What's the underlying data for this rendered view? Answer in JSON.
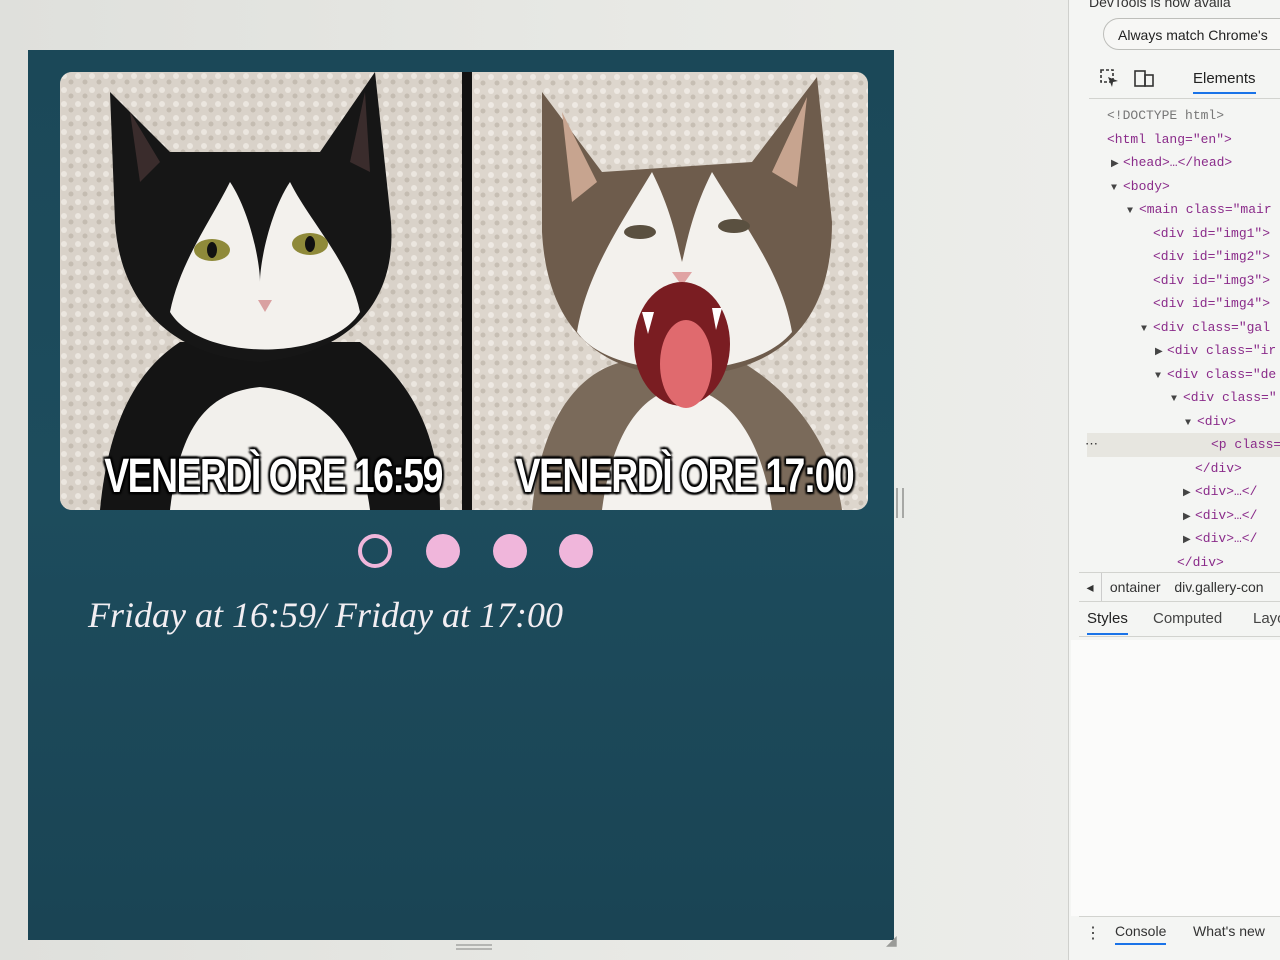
{
  "gallery": {
    "images": [
      {
        "caption": "VENERDÌ ORE 16:59",
        "subject": "black-and-white cat, grumpy expression"
      },
      {
        "caption": "VENERDÌ ORE 17:00",
        "subject": "tabby-and-white cat, mouth wide open"
      }
    ],
    "indicators": [
      {
        "state": "active"
      },
      {
        "state": "inactive"
      },
      {
        "state": "inactive"
      },
      {
        "state": "inactive"
      }
    ],
    "description": "Friday at 16:59/ Friday at 17:00"
  },
  "colors": {
    "panel_bg": "#1c4a5a",
    "indicator": "#f0b6db",
    "description_text": "#f2eef2"
  },
  "devtools": {
    "banner_text": "DevTools is now availa",
    "pill_text": "Always match Chrome's",
    "tabs": {
      "elements": "Elements"
    },
    "dom": [
      {
        "text": "<!DOCTYPE html>"
      },
      {
        "text": "<html lang=\"en\">"
      },
      {
        "text": "<head>…</head>"
      },
      {
        "text": "<body>"
      },
      {
        "text": "<main class=\"mair"
      },
      {
        "text": "<div id=\"img1\">"
      },
      {
        "text": "<div id=\"img2\">"
      },
      {
        "text": "<div id=\"img3\">"
      },
      {
        "text": "<div id=\"img4\">"
      },
      {
        "text": "<div class=\"gal"
      },
      {
        "text": "<div class=\"ir"
      },
      {
        "text": "<div class=\"de"
      },
      {
        "text": "<div class=\""
      },
      {
        "text": "<div>"
      },
      {
        "text": "<p class="
      },
      {
        "text": "</div>"
      },
      {
        "text": "<div>…</"
      },
      {
        "text": "<div>…</"
      },
      {
        "text": "<div>…</"
      },
      {
        "text": "</div>"
      }
    ],
    "breadcrumb": [
      "ontainer",
      "div.gallery-con"
    ],
    "subtabs": [
      "Styles",
      "Computed",
      "Layo"
    ],
    "drawer_tabs": [
      "Console",
      "What's new"
    ]
  }
}
